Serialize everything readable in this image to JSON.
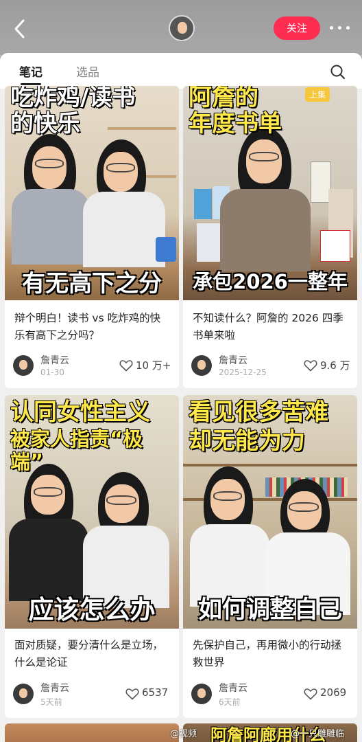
{
  "header": {
    "follow_label": "关注"
  },
  "tabs": [
    {
      "label": "笔记",
      "active": true
    },
    {
      "label": "选品",
      "active": false
    }
  ],
  "cards": [
    {
      "thumb_top_text_1": "吃炸鸡/读书",
      "thumb_top_text_2": "的快乐",
      "thumb_bottom_text": "有无高下之分",
      "badge": "",
      "title": "辩个明白！读书 vs 吃炸鸡的快乐有高下之分吗？",
      "author": "詹青云",
      "date": "01-30",
      "likes": "10 万+"
    },
    {
      "thumb_top_text_1": "阿詹的",
      "thumb_top_text_2": "年度书单",
      "thumb_bottom_text": "承包2026一整年",
      "badge": "上集",
      "title": "不知读什么？阿詹的 2026 四季书单来啦",
      "author": "詹青云",
      "date": "2025-12-25",
      "likes": "9.6 万"
    },
    {
      "thumb_top_text_1": "认同女性主义",
      "thumb_top_text_2": "被家人指责“极端”",
      "thumb_bottom_text": "应该怎么办",
      "badge": "",
      "title": "面对质疑，要分清什么是立场，什么是论证",
      "author": "詹青云",
      "date": "5天前",
      "likes": "6537"
    },
    {
      "thumb_top_text_1": "看见很多苦难",
      "thumb_top_text_2": "却无能为力",
      "thumb_bottom_text": "如何调整自己",
      "badge": "",
      "title": "先保护自己，再用微小的行动拯救世界",
      "author": "詹青云",
      "date": "6天前",
      "likes": "2069"
    }
  ],
  "partial_bottom": {
    "right_text": "阿詹阿廊用什么"
  },
  "watermarks": {
    "left": "@视频",
    "right": "@一只雕雕临"
  },
  "colors": {
    "accent": "#ff2d51",
    "text_primary": "#222222",
    "text_muted": "#aaaaaa"
  }
}
